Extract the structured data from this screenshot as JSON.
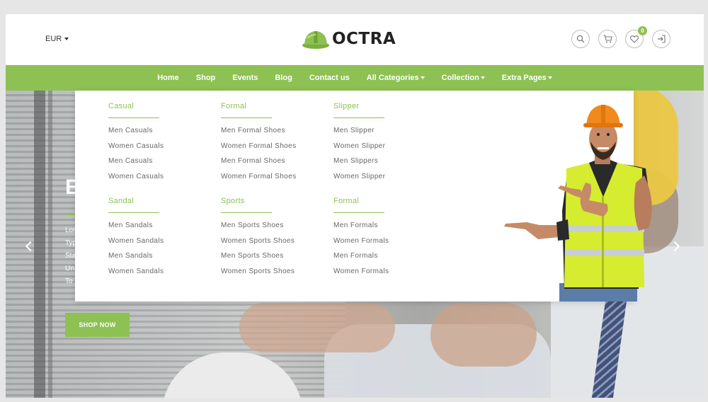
{
  "header": {
    "currency": "EUR",
    "logo_text": "OCTRA",
    "icons": [
      "search-icon",
      "cart-icon",
      "heart-icon",
      "login-icon"
    ],
    "wishlist_count": "0"
  },
  "nav": {
    "items": [
      "Home",
      "Shop",
      "Events",
      "Blog",
      "Contact us",
      "All Categories",
      "Collection",
      "Extra Pages"
    ]
  },
  "mega_menu": {
    "columns": [
      {
        "title": "Casual",
        "links": [
          "Men Casuals",
          "Women Casuals",
          "Men Casuals",
          "Women Casuals"
        ]
      },
      {
        "title": "Formal",
        "links": [
          "Men Formal Shoes",
          "Women Formal Shoes",
          "Men Formal Shoes",
          "Women Formal Shoes"
        ]
      },
      {
        "title": "Slipper",
        "links": [
          "Men Slipper",
          "Women Slipper",
          "Men Slippers",
          "Women Slipper"
        ]
      },
      {
        "title": "Sandal",
        "links": [
          "Men Sandals",
          "Women Sandals",
          "Men Sandals",
          "Women Sandals"
        ]
      },
      {
        "title": "Sports",
        "links": [
          "Men Sports Shoes",
          "Women Sports Shoes",
          "Men Sports Shoes",
          "Women Sports Shoes"
        ]
      },
      {
        "title": "Formal",
        "links": [
          "Men Formals",
          "Women Formals",
          "Men Formals",
          "Women Formals"
        ]
      }
    ]
  },
  "hero": {
    "heading_fragment": "E",
    "text_fragments": [
      "Lor",
      "Typ",
      "Sta",
      "Un",
      "To"
    ],
    "button_label": "SHOP NOW"
  },
  "colors": {
    "accent": "#8dc153",
    "nav_text": "#ffffff",
    "link_text": "#666666"
  }
}
